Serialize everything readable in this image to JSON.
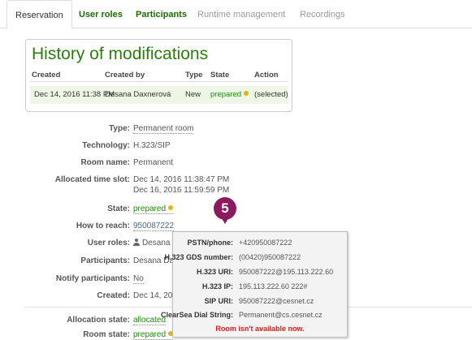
{
  "tabs": [
    {
      "label": "Reservation"
    },
    {
      "label": "User roles"
    },
    {
      "label": "Participants"
    },
    {
      "label": "Runtime management"
    },
    {
      "label": "Recordings"
    }
  ],
  "history": {
    "title": "History of modifications",
    "columns": [
      "Created",
      "Created by",
      "Type",
      "State",
      "Action"
    ],
    "row": {
      "created": "Dec 14, 2016 11:38 PM",
      "created_by": "Desana Daxnerová",
      "type": "New",
      "state": "prepared",
      "action": "(selected)"
    }
  },
  "details": {
    "type_label": "Type:",
    "type_value": "Permanent room",
    "technology_label": "Technology:",
    "technology_value": "H.323/SIP",
    "room_name_label": "Room name:",
    "room_name_value": "Permanent",
    "slot_label": "Allocated time slot:",
    "slot_start": "Dec 14, 2016 11:38:47 PM",
    "slot_end": "Dec 16, 2016 11:59:59 PM",
    "state_label": "State:",
    "state_value": "prepared",
    "reach_label": "How to reach:",
    "reach_value": "950087222",
    "user_roles_label": "User roles:",
    "user_roles_value": "Desana D",
    "participants_label": "Participants:",
    "participants_value": "Desana Da",
    "notify_label": "Notify participants:",
    "notify_value": "No",
    "created_label": "Created:",
    "created_value": "Dec 14, 201",
    "alloc_state_label": "Allocation state:",
    "alloc_state_value": "allocated",
    "room_state_label": "Room state:",
    "room_state_value": "prepared"
  },
  "badge": {
    "number": "5"
  },
  "tooltip": {
    "pstn_label": "PSTN/phone:",
    "pstn_value": "+420950087222",
    "gds_label": "H.323 GDS number:",
    "gds_value": "(00420)950087222",
    "h323uri_label": "H.323 URI:",
    "h323uri_value": "950087222@195.113.222.60",
    "h323ip_label": "H.323 IP:",
    "h323ip_value": "195.113.222.60 222#",
    "sipuri_label": "SIP URI:",
    "sipuri_value": "950087222@cesnet.cz",
    "clearsea_label": "ClearSea Dial String:",
    "clearsea_value": "Permanent@cs.cesnet.cz",
    "warning": "Room isn't available now."
  },
  "colors": {
    "accent": "#2a7d0e",
    "badge": "#8b1a5e",
    "warning": "#d22020",
    "state_dot": "#e2b514"
  }
}
